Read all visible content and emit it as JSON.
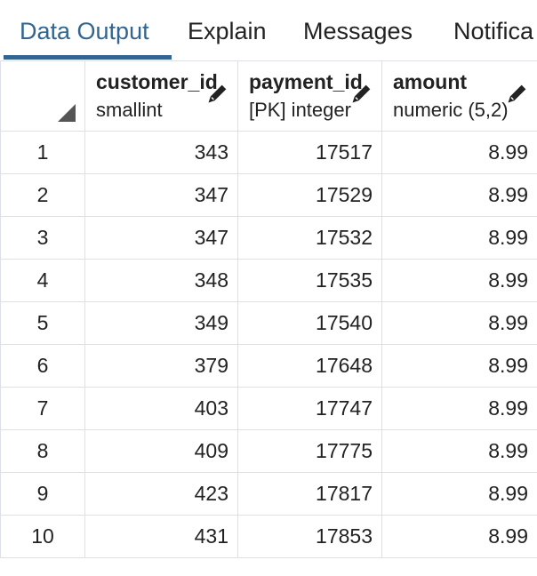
{
  "tabs": [
    {
      "label": "Data Output",
      "active": true
    },
    {
      "label": "Explain",
      "active": false
    },
    {
      "label": "Messages",
      "active": false
    },
    {
      "label": "Notifica",
      "active": false
    }
  ],
  "grid": {
    "columns": [
      {
        "name": "customer_id",
        "type": "smallint",
        "editable_icon": "pencil-icon"
      },
      {
        "name": "payment_id",
        "type": "[PK] integer",
        "editable_icon": "pencil-icon"
      },
      {
        "name": "amount",
        "type": "numeric (5,2)",
        "editable_icon": "pencil-icon"
      }
    ],
    "rows": [
      {
        "n": "1",
        "customer_id": "343",
        "payment_id": "17517",
        "amount": "8.99"
      },
      {
        "n": "2",
        "customer_id": "347",
        "payment_id": "17529",
        "amount": "8.99"
      },
      {
        "n": "3",
        "customer_id": "347",
        "payment_id": "17532",
        "amount": "8.99"
      },
      {
        "n": "4",
        "customer_id": "348",
        "payment_id": "17535",
        "amount": "8.99"
      },
      {
        "n": "5",
        "customer_id": "349",
        "payment_id": "17540",
        "amount": "8.99"
      },
      {
        "n": "6",
        "customer_id": "379",
        "payment_id": "17648",
        "amount": "8.99"
      },
      {
        "n": "7",
        "customer_id": "403",
        "payment_id": "17747",
        "amount": "8.99"
      },
      {
        "n": "8",
        "customer_id": "409",
        "payment_id": "17775",
        "amount": "8.99"
      },
      {
        "n": "9",
        "customer_id": "423",
        "payment_id": "17817",
        "amount": "8.99"
      },
      {
        "n": "10",
        "customer_id": "431",
        "payment_id": "17853",
        "amount": "8.99"
      }
    ]
  },
  "colors": {
    "accent": "#326690",
    "grid_line": "#dde0e6",
    "text": "#222222"
  }
}
